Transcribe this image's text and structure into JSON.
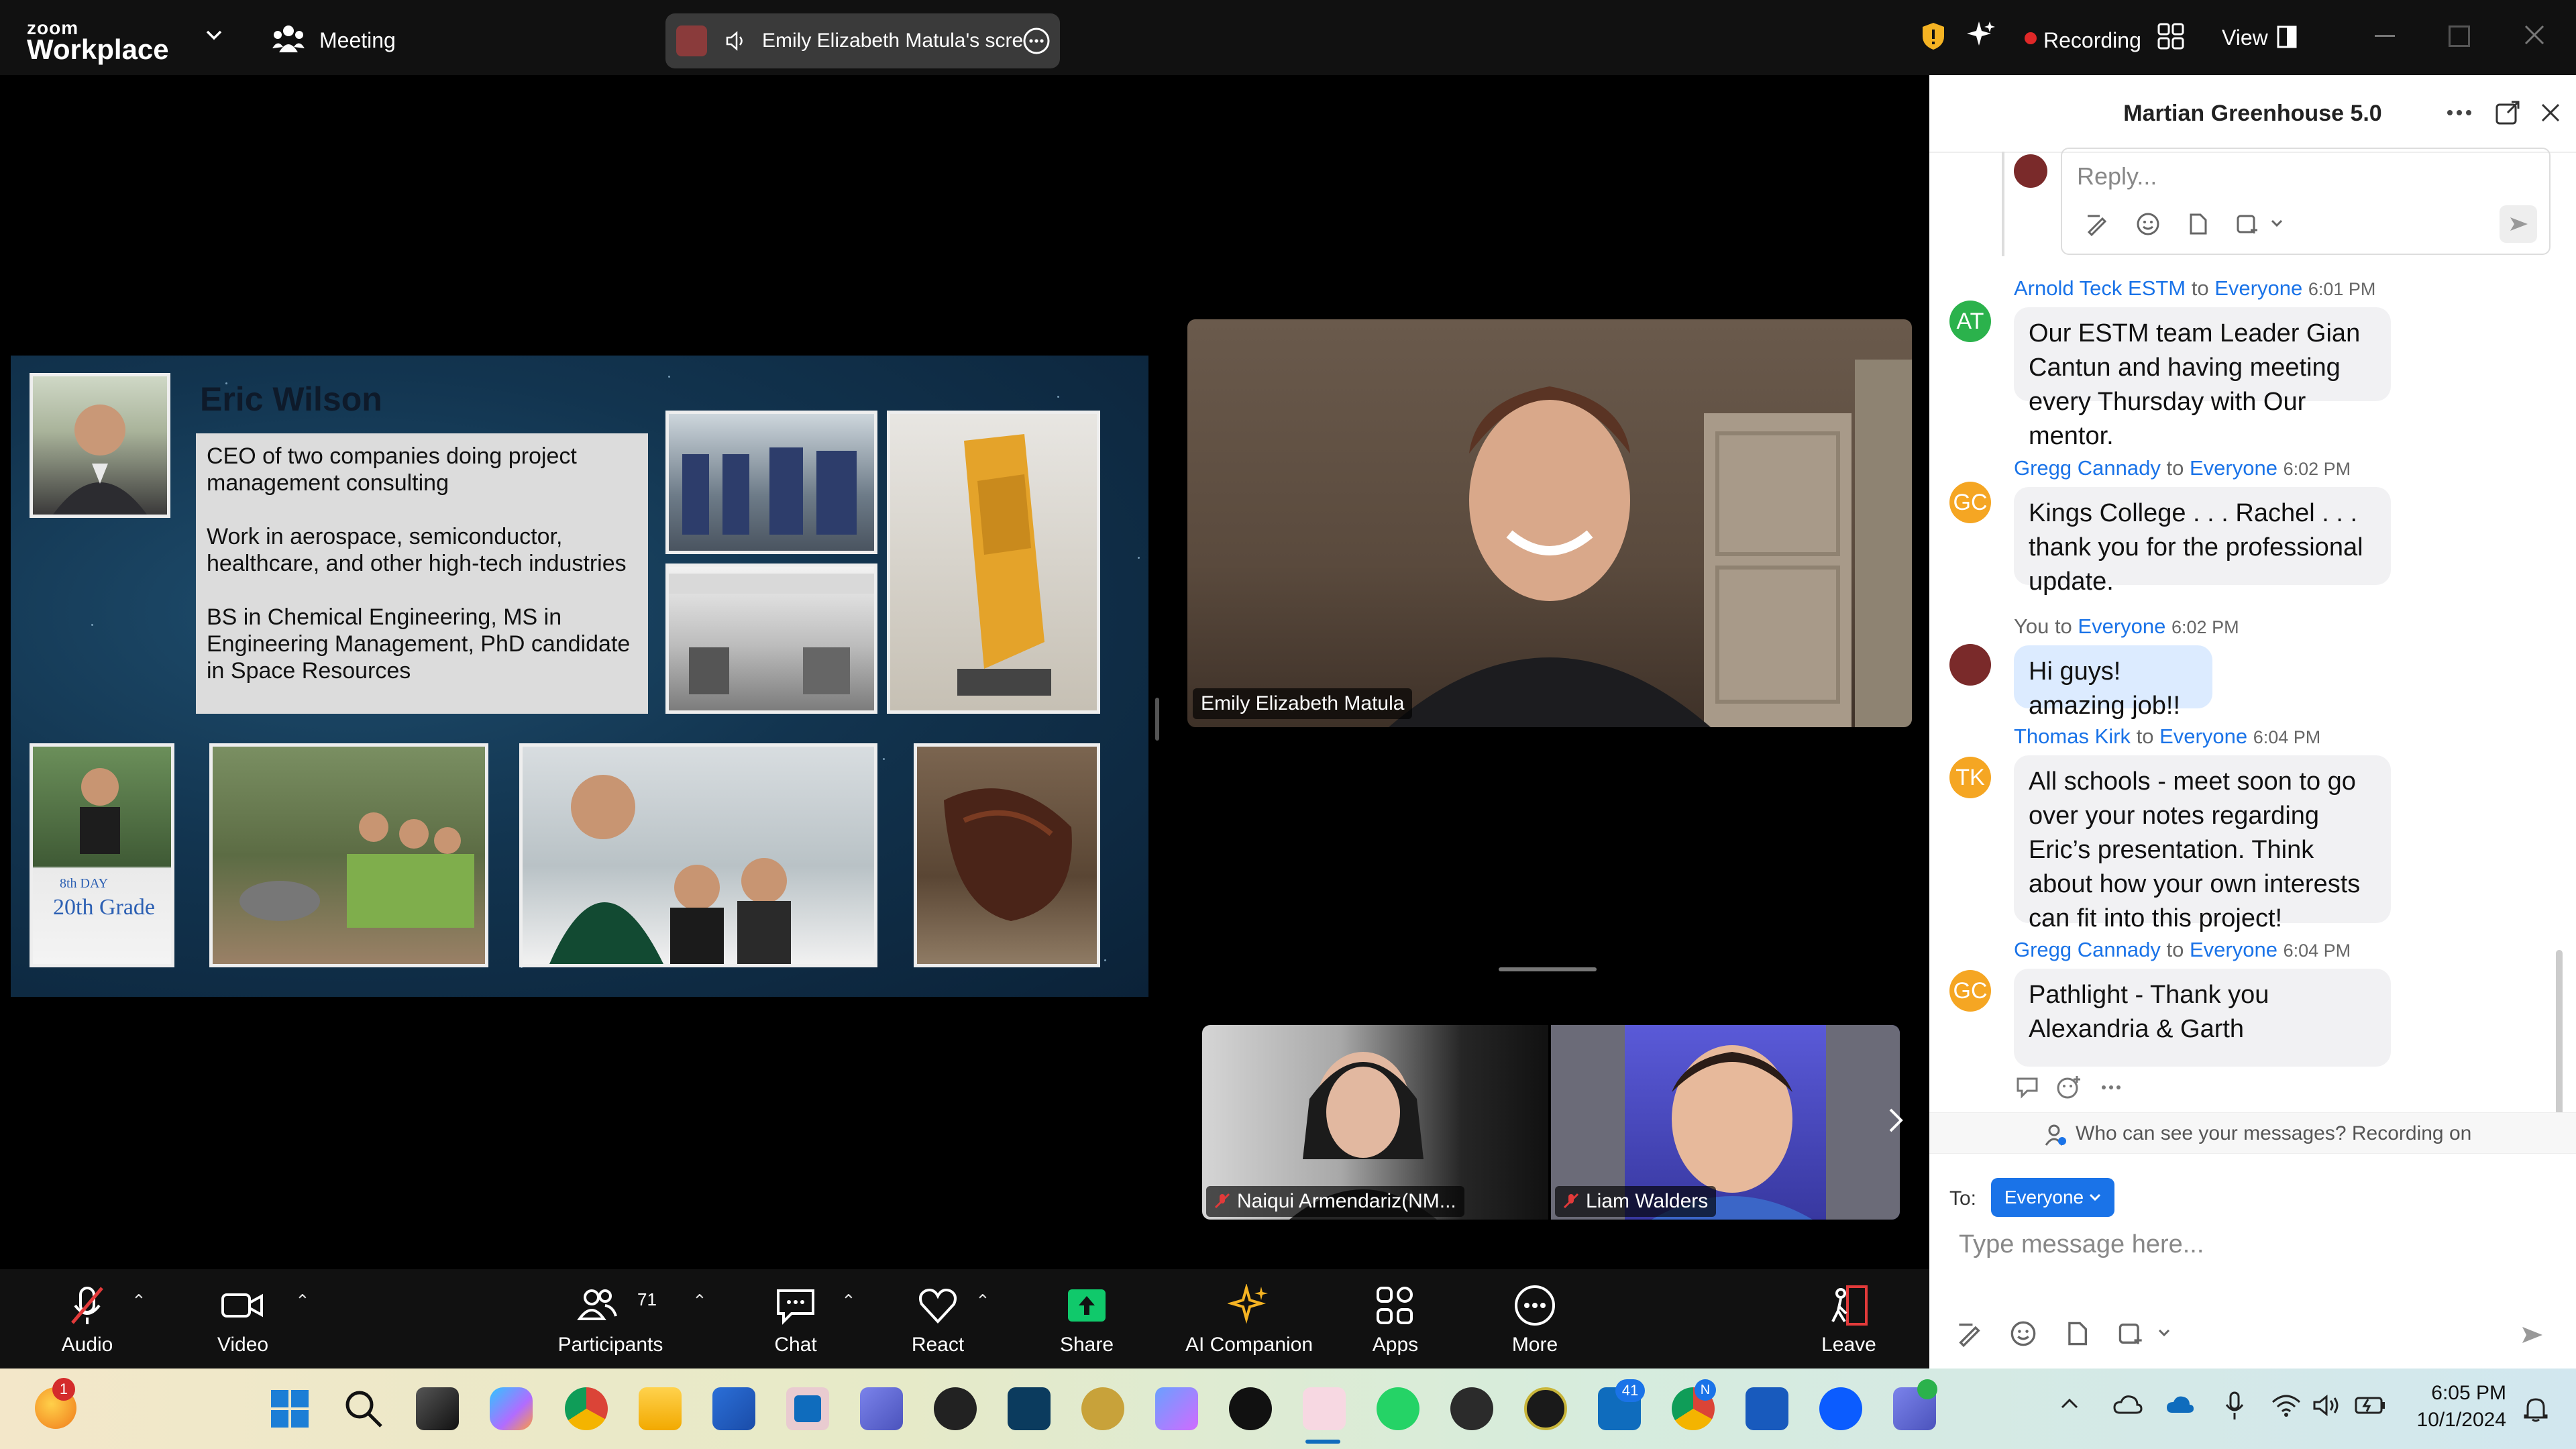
{
  "app": {
    "logo_small": "zoom",
    "logo_big": "Workplace",
    "meeting_label": "Meeting",
    "share_pill_text": "Emily Elizabeth Matula's scre",
    "recording_label": "Recording",
    "view_label": "View"
  },
  "slide": {
    "title": "Eric Wilson",
    "bio": [
      "CEO of two companies doing project management consulting",
      "Work in aerospace, semiconductor, healthcare, and other high-tech industries",
      "BS in Chemical Engineering, MS in Engineering Management, PhD candidate in Space Resources"
    ],
    "poster_text_1": "8th DAY",
    "poster_text_2": "20th Grade"
  },
  "videos": {
    "main_name": "Emily Elizabeth Matula",
    "thumb1_name": "Naiqui Armendariz(NM...",
    "thumb2_name": "Liam Walders"
  },
  "toolbar": {
    "audio": "Audio",
    "video": "Video",
    "participants": "Participants",
    "participants_count": "71",
    "chat": "Chat",
    "react": "React",
    "share": "Share",
    "ai": "AI Companion",
    "apps": "Apps",
    "more": "More",
    "leave": "Leave"
  },
  "chat": {
    "title": "Martian Greenhouse 5.0",
    "reply_placeholder": "Reply...",
    "to_word": "to",
    "messages": [
      {
        "initials": "AT",
        "avatar_color": "#2bb24c",
        "sender": "Arnold Teck ESTM",
        "recipient": "Everyone",
        "time": "6:01 PM",
        "text": "Our ESTM team Leader Gian Cantun and having meeting every Thursday with Our mentor."
      },
      {
        "initials": "GC",
        "avatar_color": "#f5a623",
        "sender": "Gregg Cannady",
        "recipient": "Everyone",
        "time": "6:02 PM",
        "text": "Kings College . . .  Rachel . . .  thank you for the professional update."
      },
      {
        "initials": "",
        "avatar_color": "#7a2a2a",
        "sender": "You",
        "recipient": "Everyone",
        "time": "6:02 PM",
        "text": "Hi guys! amazing job!!"
      },
      {
        "initials": "TK",
        "avatar_color": "#f5a623",
        "sender": "Thomas Kirk",
        "recipient": "Everyone",
        "time": "6:04 PM",
        "text": "All schools - meet soon to go over your notes regarding Eric’s presentation.  Think about how your own interests can fit into this project!"
      },
      {
        "initials": "GC",
        "avatar_color": "#f5a623",
        "sender": "Gregg Cannady",
        "recipient": "Everyone",
        "time": "6:04 PM",
        "text": "Pathlight - Thank you Alexandria & Garth"
      }
    ],
    "visibility_note": "Who can see your messages? Recording on",
    "to_label": "To:",
    "recipient_button": "Everyone",
    "input_placeholder": "Type message here..."
  },
  "taskbar": {
    "time": "6:05 PM",
    "date": "10/1/2024",
    "notif_badge": "1",
    "outlook_badge": "41",
    "chrome_badge": "N"
  }
}
